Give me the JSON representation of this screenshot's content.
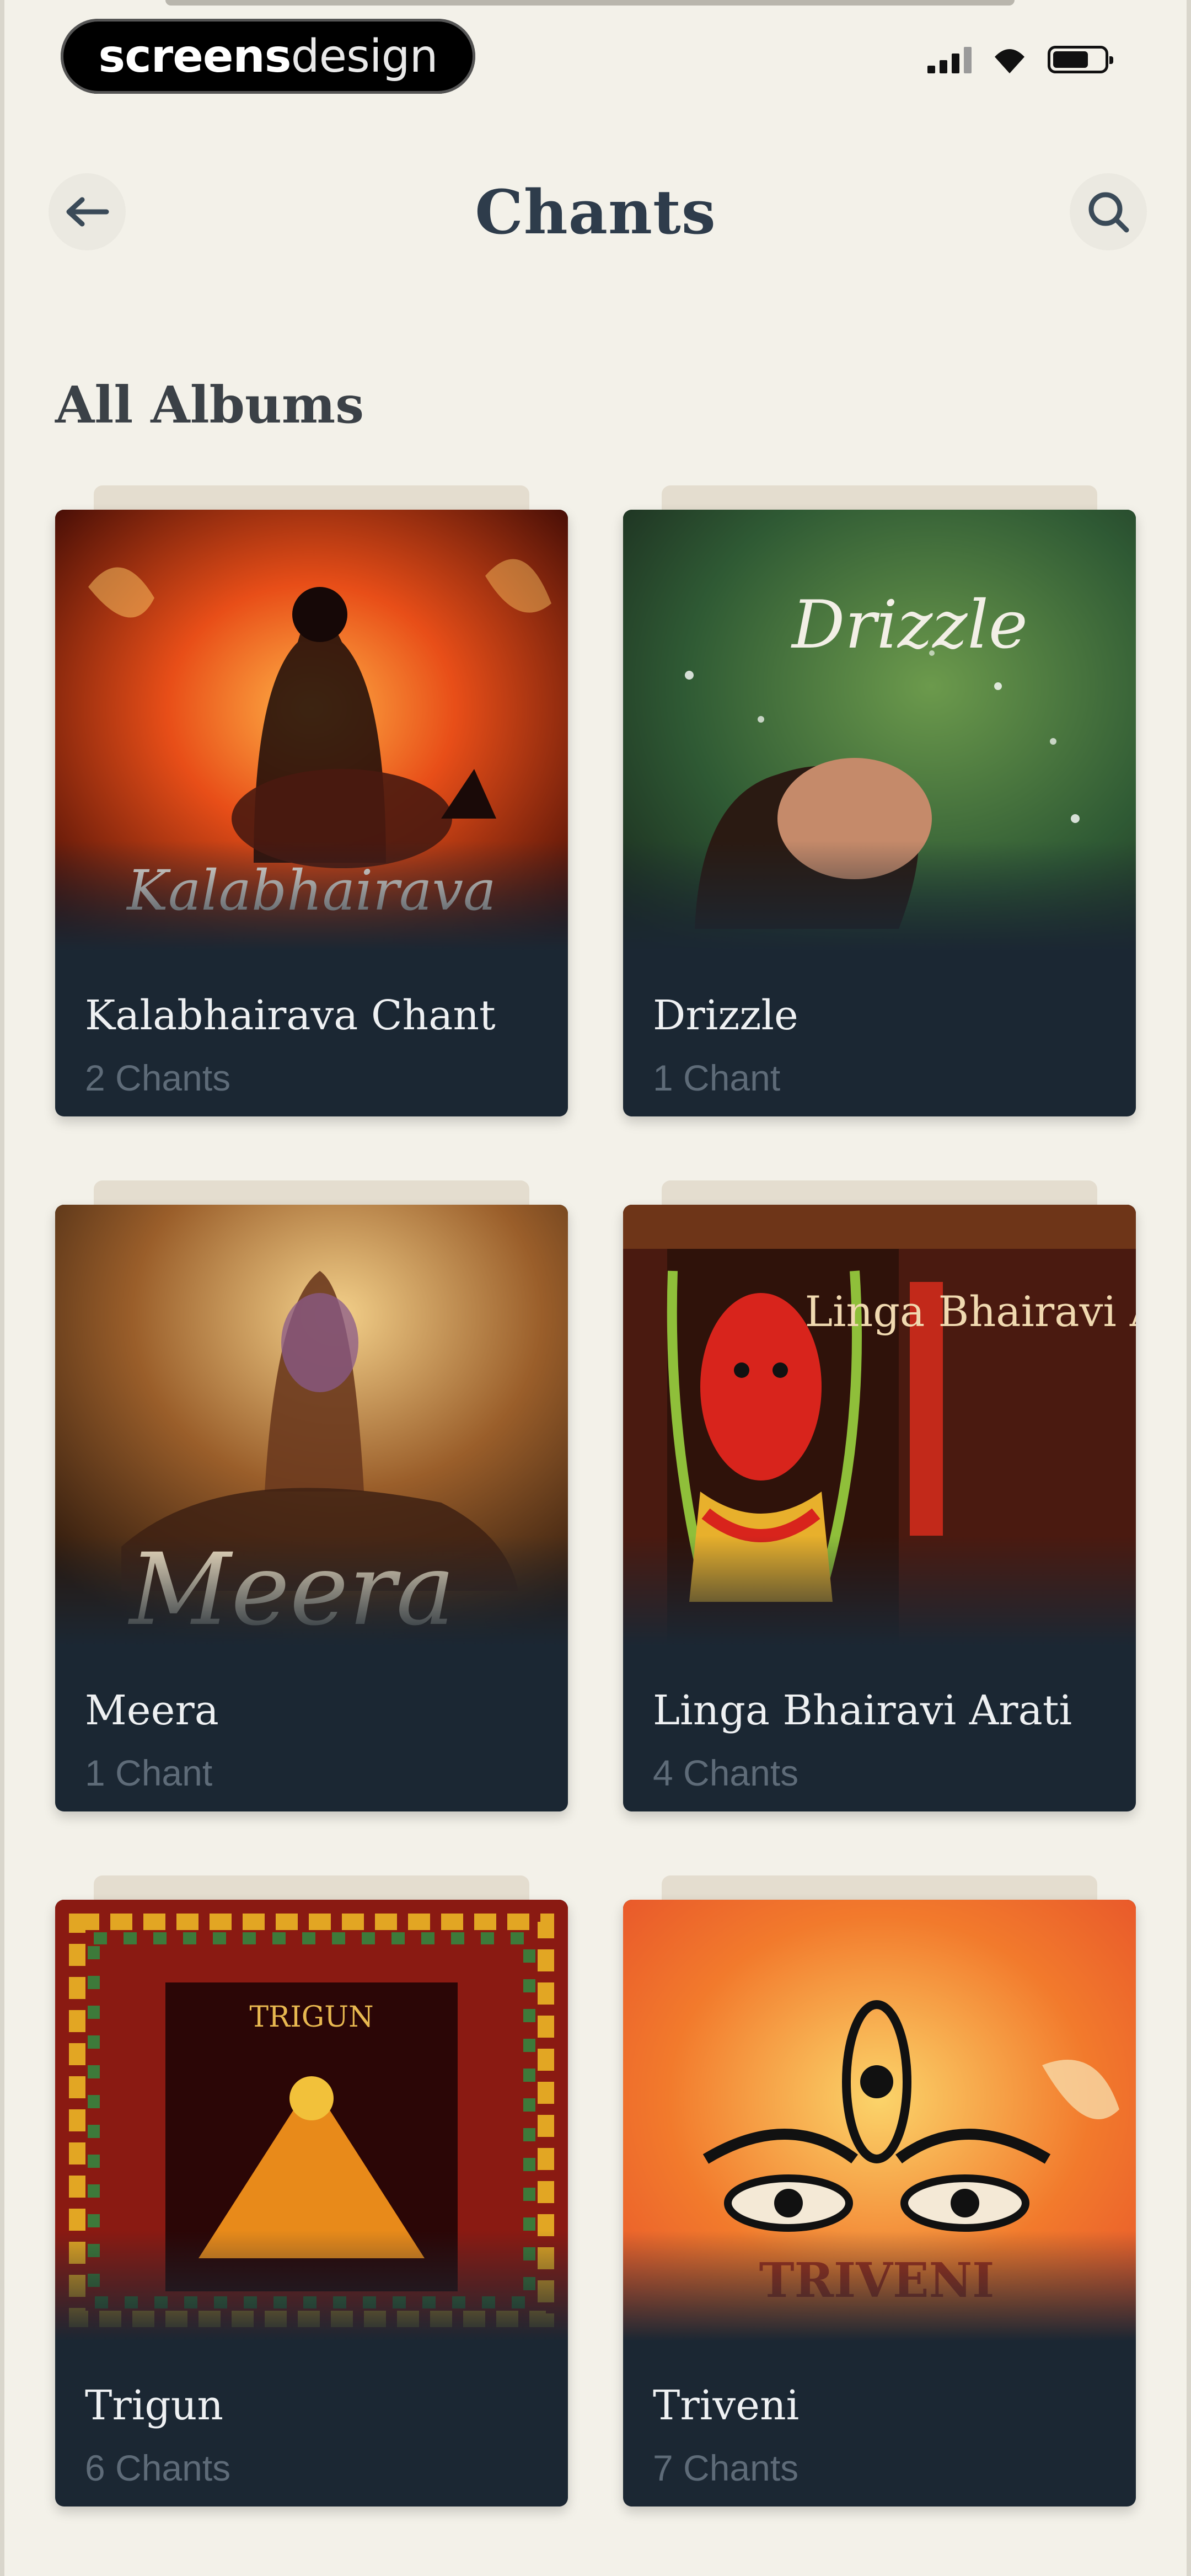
{
  "status_bar": {
    "brand_bold": "screens",
    "brand_light": "design"
  },
  "header": {
    "title": "Chants",
    "back_icon": "arrow-left-icon",
    "search_icon": "search-icon"
  },
  "section": {
    "title": "All Albums"
  },
  "albums": [
    {
      "title": "Kalabhairava Chant",
      "count": "2 Chants",
      "cover_text": "Kalabhairava",
      "colors": [
        "#d8401a",
        "#2a0e0a"
      ]
    },
    {
      "title": "Drizzle",
      "count": "1 Chant",
      "cover_text": "Drizzle",
      "colors": [
        "#3f6e3a",
        "#1c2d20"
      ]
    },
    {
      "title": "Meera",
      "count": "1 Chant",
      "cover_text": "Meera",
      "colors": [
        "#b8853e",
        "#3a2313"
      ]
    },
    {
      "title": "Linga Bhairavi Arati",
      "count": "4 Chants",
      "cover_text": "Linga Bhairavi Arati",
      "colors": [
        "#6b1a10",
        "#2a1208"
      ]
    },
    {
      "title": "Trigun",
      "count": "6 Chants",
      "cover_text": "TRIGUN",
      "colors": [
        "#7a1a10",
        "#2a0808"
      ]
    },
    {
      "title": "Triveni",
      "count": "7 Chants",
      "cover_text": "TRIVENI",
      "colors": [
        "#f06a2a",
        "#f7b24a"
      ]
    }
  ]
}
